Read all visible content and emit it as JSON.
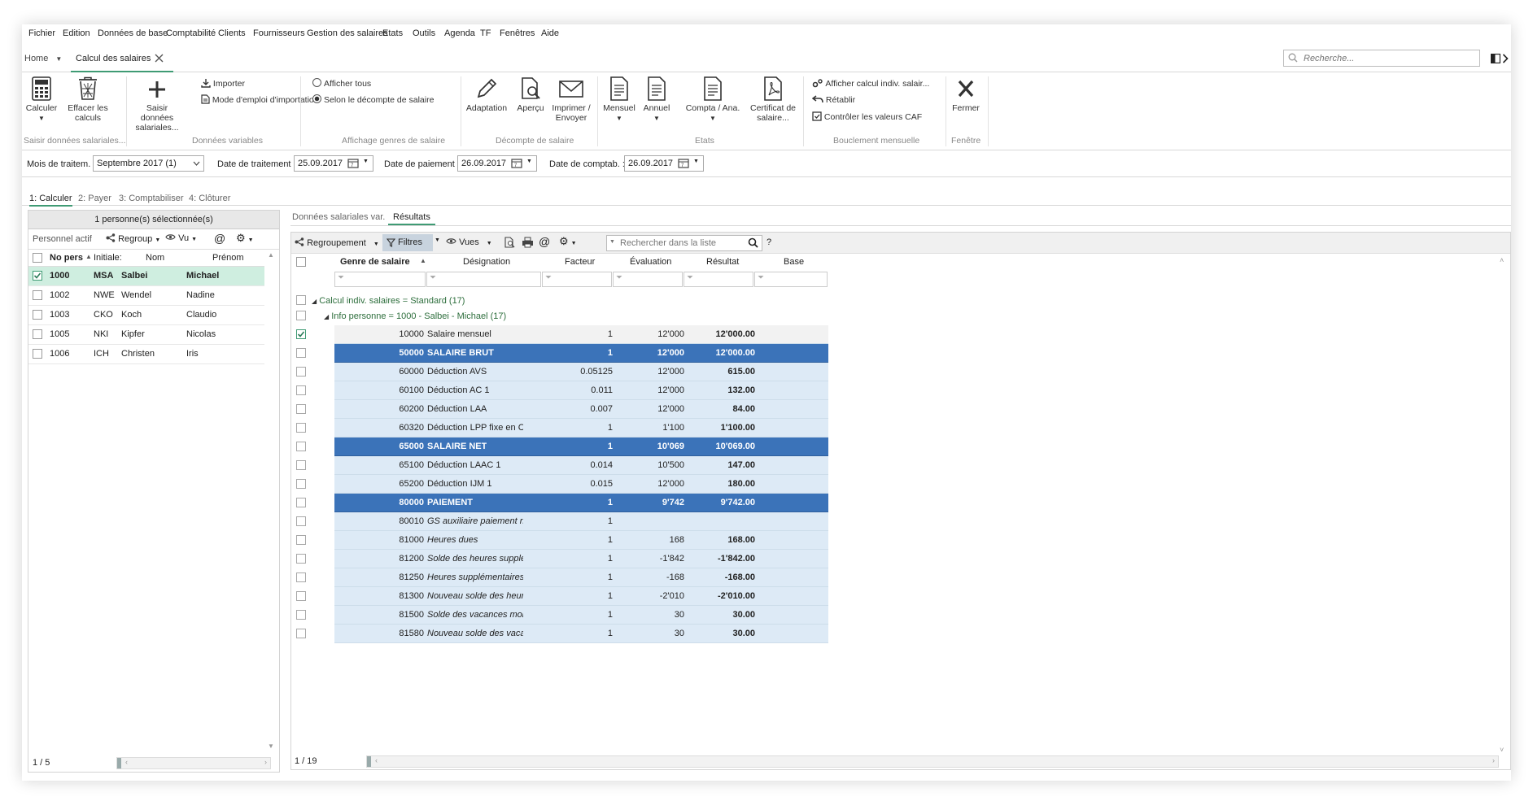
{
  "menu": [
    "Fichier",
    "Edition",
    "Données de base",
    "Comptabilité",
    "Clients",
    "Fournisseurs",
    "Gestion des salaires",
    "Etats",
    "Outils",
    "Agenda",
    "TF",
    "Fenêtres",
    "Aide"
  ],
  "tabs": {
    "home": "Home",
    "active": "Calcul des salaires"
  },
  "search": {
    "placeholder": "Recherche..."
  },
  "ribbon": {
    "calculer": "Calculer",
    "effacer": "Effacer les calculs",
    "saisir": "Saisir données salariales...",
    "importer": "Importer",
    "mode_emploi": "Mode d'emploi d'importation",
    "afficher_tous": "Afficher tous",
    "selon_decompte": "Selon le décompte de salaire",
    "adaptation": "Adaptation",
    "apercu": "Aperçu",
    "imprimer": "Imprimer / Envoyer",
    "mensuel": "Mensuel",
    "annuel": "Annuel",
    "compta": "Compta / Ana.",
    "certificat": "Certificat de salaire...",
    "afficher_calcul": "Afficher calcul indiv. salair...",
    "retablir": "Rétablir",
    "controler": "Contrôler les valeurs CAF",
    "fermer": "Fermer",
    "groups": {
      "saisir": "Saisir données salariales...",
      "donnees_variables": "Données variables",
      "affichage": "Affichage genres de salaire",
      "decompte": "Décompte de salaire",
      "etats": "Etats",
      "bouclement": "Bouclement mensuelle",
      "fenetre": "Fenêtre"
    }
  },
  "dates": {
    "mois_label": "Mois de traitem. :",
    "mois_value": "Septembre 2017 (1)",
    "traitement_label": "Date de traitement :",
    "traitement_value": "25.09.2017",
    "paiement_label": "Date de paiement :",
    "paiement_value": "26.09.2017",
    "comptab_label": "Date de comptab. :",
    "comptab_value": "26.09.2017"
  },
  "steps": [
    "1: Calculer",
    "2: Payer",
    "3: Comptabiliser",
    "4: Clôturer"
  ],
  "left": {
    "header": "1 personne(s) sélectionnée(s)",
    "filter": "Personnel actif",
    "regroup": "Regroup",
    "vu": "Vu",
    "columns": {
      "no": "No pers",
      "init": "Initiale:",
      "nom": "Nom",
      "prenom": "Prénom"
    },
    "rows": [
      {
        "no": "1000",
        "init": "MSA",
        "nom": "Salbei",
        "prenom": "Michael"
      },
      {
        "no": "1002",
        "init": "NWE",
        "nom": "Wendel",
        "prenom": "Nadine"
      },
      {
        "no": "1003",
        "init": "CKO",
        "nom": "Koch",
        "prenom": "Claudio"
      },
      {
        "no": "1005",
        "init": "NKI",
        "nom": "Kipfer",
        "prenom": "Nicolas"
      },
      {
        "no": "1006",
        "init": "ICH",
        "nom": "Christen",
        "prenom": "Iris"
      }
    ],
    "count": "1 / 5"
  },
  "right": {
    "tabs": [
      "Données salariales var.",
      "Résultats"
    ],
    "regroupement": "Regroupement",
    "filtres": "Filtres",
    "vues": "Vues",
    "search_placeholder": "Rechercher dans la liste",
    "help": "?",
    "columns": {
      "genre": "Genre de salaire",
      "designation": "Désignation",
      "facteur": "Facteur",
      "evaluation": "Évaluation",
      "resultat": "Résultat",
      "base": "Base"
    },
    "group1": "Calcul indiv. salaires = Standard (17)",
    "group2": "Info personne = 1000 - Salbei - Michael (17)",
    "rows": [
      {
        "code": "10000",
        "des": "Salaire mensuel",
        "fac": "1",
        "eval": "12'000",
        "res": "12'000.00",
        "type": "first"
      },
      {
        "code": "50000",
        "des": "SALAIRE BRUT",
        "fac": "1",
        "eval": "12'000",
        "res": "12'000.00",
        "type": "sub"
      },
      {
        "code": "60000",
        "des": "Déduction AVS",
        "fac": "0.05125",
        "eval": "12'000",
        "res": "615.00",
        "type": "row"
      },
      {
        "code": "60100",
        "des": "Déduction AC 1",
        "fac": "0.011",
        "eval": "12'000",
        "res": "132.00",
        "type": "row"
      },
      {
        "code": "60200",
        "des": "Déduction LAA",
        "fac": "0.007",
        "eval": "12'000",
        "res": "84.00",
        "type": "row"
      },
      {
        "code": "60320",
        "des": "Déduction LPP fixe en CHF",
        "fac": "1",
        "eval": "1'100",
        "res": "1'100.00",
        "type": "row"
      },
      {
        "code": "65000",
        "des": "SALAIRE NET",
        "fac": "1",
        "eval": "10'069",
        "res": "10'069.00",
        "type": "sub"
      },
      {
        "code": "65100",
        "des": "Déduction LAAC 1",
        "fac": "0.014",
        "eval": "10'500",
        "res": "147.00",
        "type": "row"
      },
      {
        "code": "65200",
        "des": "Déduction IJM 1",
        "fac": "0.015",
        "eval": "12'000",
        "res": "180.00",
        "type": "row"
      },
      {
        "code": "80000",
        "des": "PAIEMENT",
        "fac": "1",
        "eval": "9'742",
        "res": "9'742.00",
        "type": "sub"
      },
      {
        "code": "80010",
        "des": "GS auxiliaire paiement negatif",
        "fac": "1",
        "eval": "",
        "res": "",
        "type": "ital"
      },
      {
        "code": "81000",
        "des": "Heures dues",
        "fac": "1",
        "eval": "168",
        "res": "168.00",
        "type": "ital"
      },
      {
        "code": "81200",
        "des": "Solde des heures supplémenta",
        "fac": "1",
        "eval": "-1'842",
        "res": "-1'842.00",
        "type": "ital"
      },
      {
        "code": "81250",
        "des": "Heures supplémentaires effecti",
        "fac": "1",
        "eval": "-168",
        "res": "-168.00",
        "type": "ital"
      },
      {
        "code": "81300",
        "des": "Nouveau solde des heures sup",
        "fac": "1",
        "eval": "-2'010",
        "res": "-2'010.00",
        "type": "ital"
      },
      {
        "code": "81500",
        "des": "Solde des vacances mois préc",
        "fac": "1",
        "eval": "30",
        "res": "30.00",
        "type": "ital"
      },
      {
        "code": "81580",
        "des": "Nouveau solde des vacances",
        "fac": "1",
        "eval": "30",
        "res": "30.00",
        "type": "ital"
      }
    ],
    "count": "1 / 19"
  },
  "colors": {
    "accent": "#3f9b74",
    "subtotal": "#3b73b9",
    "row": "#ddeaf6",
    "selected": "#cfeee0"
  }
}
